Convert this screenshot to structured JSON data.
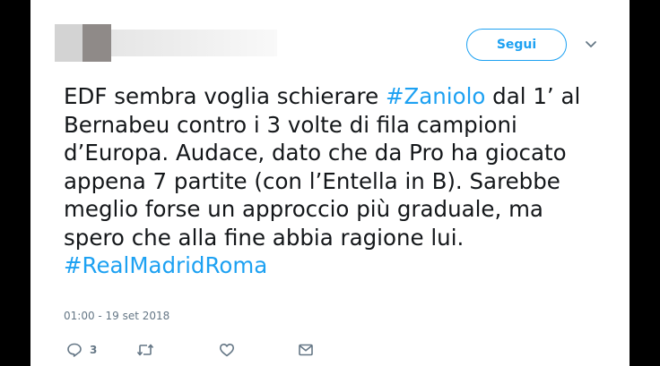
{
  "follow_button": {
    "label": "Segui"
  },
  "tweet": {
    "lines": [
      [
        {
          "t": "EDF sembra voglia schierare ",
          "h": false
        },
        {
          "t": "#Zaniolo",
          "h": true
        },
        {
          "t": " dal 1’ al",
          "h": false
        }
      ],
      [
        {
          "t": "Bernabeu contro i 3 volte di fila campioni",
          "h": false
        }
      ],
      [
        {
          "t": "d’Europa. Audace, dato che da Pro ha giocato",
          "h": false
        }
      ],
      [
        {
          "t": "appena 7 partite (con l’Entella in B). Sarebbe",
          "h": false
        }
      ],
      [
        {
          "t": "meglio forse un approccio più graduale, ma",
          "h": false
        }
      ],
      [
        {
          "t": "spero che alla fine abbia ragione lui.",
          "h": false
        }
      ],
      [
        {
          "t": "#RealMadridRoma",
          "h": true
        }
      ]
    ],
    "timestamp": "01:00 - 19 set 2018"
  },
  "actions": {
    "reply_count": "3",
    "icons": [
      "reply-icon",
      "retweet-icon",
      "like-icon",
      "direct-message-icon"
    ]
  },
  "colors": {
    "accent": "#1da1f2",
    "text": "#14171a",
    "muted": "#657786",
    "background": "#000000"
  }
}
